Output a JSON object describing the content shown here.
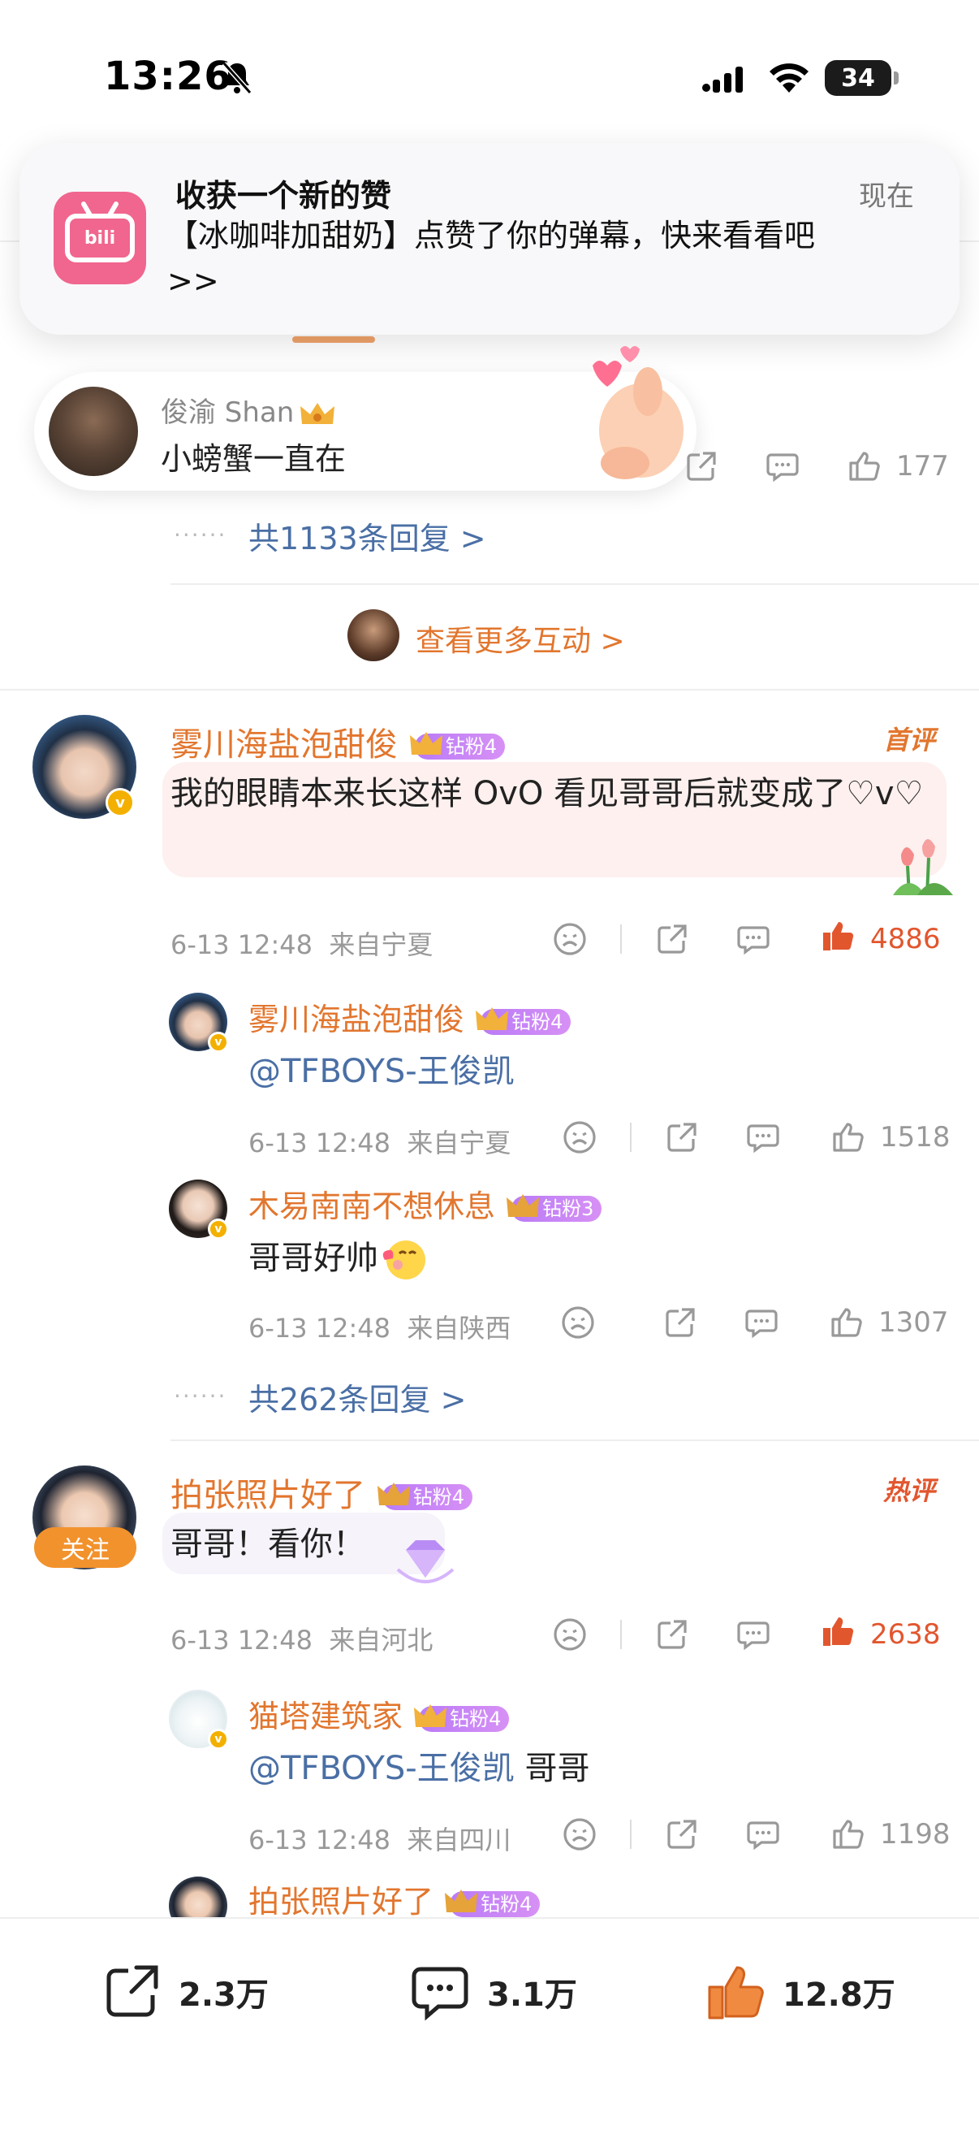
{
  "status_bar": {
    "time": "13:26",
    "battery": "34"
  },
  "banner": {
    "title": "收获一个新的赞",
    "time": "现在",
    "body": "【冰咖啡加甜奶】点赞了你的弹幕，快来看看吧>>"
  },
  "danmu": {
    "name": "俊渝 Shan",
    "text": "小螃蟹一直在"
  },
  "prev_thread": {
    "like_count": "177",
    "reply_summary": "共1133条回复 >",
    "more_interaction": "查看更多互动 >"
  },
  "comments": [
    {
      "username": "雾川海盐泡甜俊",
      "badge": "钻粉4",
      "tag": "首评",
      "text": "我的眼睛本来长这样 OvO  看见哥哥后就变成了♡v♡",
      "date": "6-13 12:48",
      "location": "来自宁夏",
      "like_count": "4886",
      "replies": [
        {
          "username": "雾川海盐泡甜俊",
          "badge": "钻粉4",
          "text": "@TFBOYS-王俊凯",
          "date": "6-13 12:48",
          "location": "来自宁夏",
          "like_count": "1518"
        },
        {
          "username": "木易南南不想休息",
          "badge": "钻粉3",
          "text": "哥哥好帅",
          "date": "6-13 12:48",
          "location": "来自陕西",
          "like_count": "1307"
        }
      ],
      "reply_summary": "共262条回复 >"
    },
    {
      "username": "拍张照片好了",
      "badge": "钻粉4",
      "tag": "热评",
      "follow": "关注",
      "text": "哥哥！看你！",
      "date": "6-13 12:48",
      "location": "来自河北",
      "like_count": "2638",
      "replies": [
        {
          "username": "猫塔建筑家",
          "badge": "钻粉4",
          "mention": "@TFBOYS-王俊凯",
          "text": " 哥哥",
          "date": "6-13 12:48",
          "location": "来自四川",
          "like_count": "1198"
        },
        {
          "username": "拍张照片好了",
          "badge": "钻粉4"
        }
      ]
    }
  ],
  "bottom_bar": {
    "share": "2.3万",
    "comment": "3.1万",
    "like": "12.8万"
  },
  "colors": {
    "accent": "#e2762e",
    "link": "#4a6fa5",
    "badge": "#c785f5",
    "like_hot": "#e2562e",
    "bilibili_pink": "#f0668e"
  }
}
